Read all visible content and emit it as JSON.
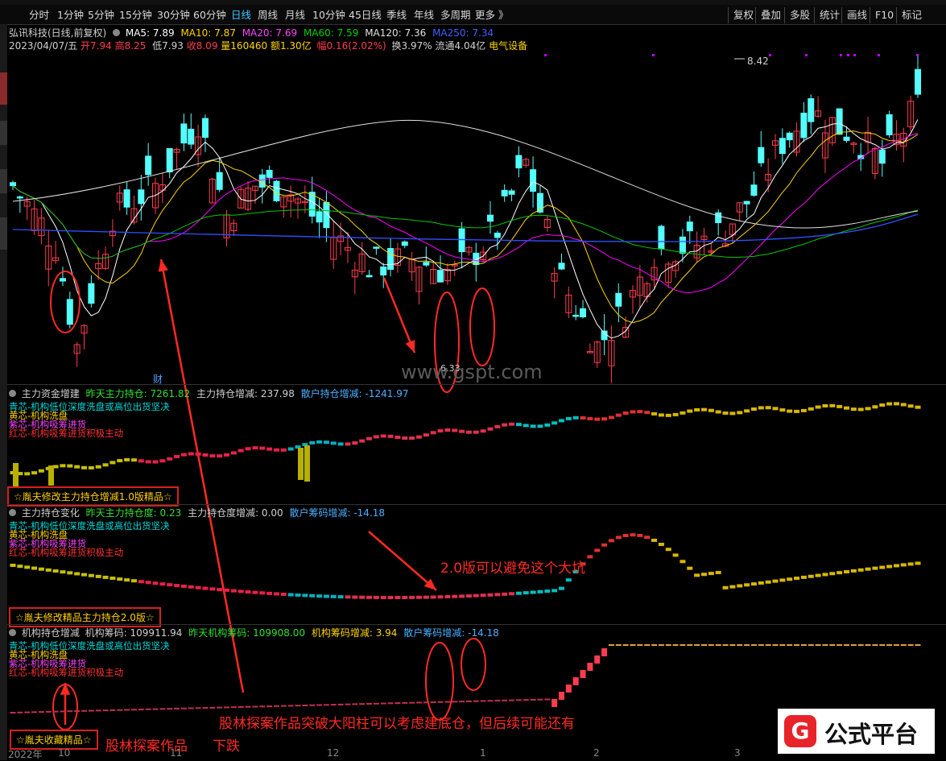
{
  "toolbar": {
    "periods": [
      "分时",
      "1分钟",
      "5分钟",
      "15分钟",
      "30分钟",
      "60分钟",
      "日线",
      "周线",
      "月线",
      "10分钟",
      "45日线",
      "季线",
      "年线",
      "多周期",
      "更多 》"
    ],
    "active_period": "日线",
    "tools": [
      "复权",
      "叠加",
      "多股",
      "统计",
      "画线",
      "F10",
      "标记"
    ]
  },
  "stock": {
    "name_line": "弘讯科技(日线,前复权)",
    "ma5": "MA5: 7.89",
    "ma10": "MA10: 7.87",
    "ma20": "MA20: 7.69",
    "ma60": "MA60: 7.59",
    "ma120": "MA120: 7.36",
    "ma250": "MA250: 7.34",
    "date": "2023/04/07/五",
    "open": "开7.94",
    "high": "高8.25",
    "low": "低7.93",
    "close": "收8.09",
    "volume": "量160460",
    "amount": "额1.30亿",
    "change": "幅0.16(2.02%)",
    "turnover": "换3.97%",
    "float": "流通4.04亿",
    "sector": "电气设备"
  },
  "price_marks": {
    "high": "8.42",
    "low": "6.33",
    "cai": "财"
  },
  "panel1": {
    "title": "主力资金增建",
    "v1": "昨天主力持仓: 7261.82",
    "v2": "主力持仓增减: 237.98",
    "v3": "散户持仓增减: -1241.97",
    "legend": [
      "青芯-机构低位深度洗盘或高位出货坚决",
      "黄芯-机构洗盘",
      "紫芯-机构吸筹进货",
      "红芯-机构吸筹进货积极主动"
    ],
    "box": "☆胤夫修改主力持仓增减1.0版精品☆"
  },
  "panel2": {
    "title": "主力持仓变化",
    "v1": "昨天主力持仓度: 0.23",
    "v2": "主力持仓度增减: 0.00",
    "v3": "散户筹码增减: -14.18",
    "legend": [
      "青芯-机构低位深度洗盘或高位出货坚决",
      "黄芯-机构洗盘",
      "紫芯-机构吸筹进货",
      "红芯-机构吸筹进货积极主动"
    ],
    "box": "☆胤夫修改精品主力持仓2.0版☆"
  },
  "panel3": {
    "title": "机构持仓增减",
    "v0": "机构筹码: 109911.94",
    "v1": "昨天机构筹码: 109908.00",
    "v2": "机构筹码增减: 3.94",
    "v3": "散户筹码增减: -14.18",
    "legend": [
      "青芯-机构低位深度洗盘或高位出货坚决",
      "黄芯-机构洗盘",
      "紫芯-机构吸筹进货",
      "红芯-机构吸筹进货积极主动"
    ],
    "box": "☆胤夫收藏精品☆"
  },
  "annotations": {
    "a1": "2.0版可以避免这个大坑",
    "a2": "股林探案作品突破大阳柱可以考虑建底仓，但后续可能还有",
    "a3": "股林探案作品",
    "a4": "下跌"
  },
  "xaxis": [
    "2022年",
    "10",
    "11",
    "12",
    "1",
    "2",
    "3"
  ],
  "watermark": "www.gspt.com",
  "logo": {
    "icon": "G",
    "text": "公式平台"
  },
  "colors": {
    "up": "#ff3c4e",
    "down": "#54ffff",
    "red_annot": "#ff2a22",
    "ma5": "#ffffff",
    "ma10": "#ffd400",
    "ma20": "#ff00ff",
    "ma60": "#00c800",
    "ma120": "#e0e0e0",
    "ma250": "#3050ff"
  }
}
